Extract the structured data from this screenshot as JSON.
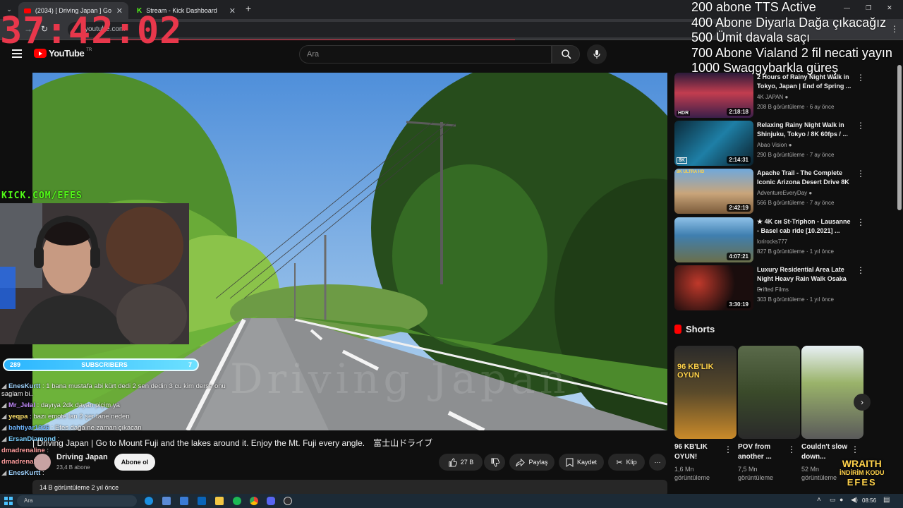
{
  "browser": {
    "tabs": [
      {
        "label": "(2034) [ Driving Japan ] Go to M",
        "active": true
      },
      {
        "label": "Stream - Kick Dashboard",
        "active": false
      }
    ],
    "new_tab": "+",
    "url": "youtube.com"
  },
  "overlay": {
    "timer": "37:42:02",
    "goals": [
      "200 abone TTS Active",
      "400 Abone Diyarla Dağa çıkacağız",
      "500 Ümit davala saçı",
      "700 Abone Vialand 2 fil necati yayın",
      "1000 Swaggybarkla güreş"
    ],
    "kick_handle": "KICK.COM/EFES",
    "subscribers": {
      "count": "289",
      "label": "SUBSCRIBERS",
      "goal_left": "7"
    },
    "chat": [
      {
        "user": "EnesKurtt",
        "msg": "1 bana mustafa abi kürt dedi 2 sen dedin 3 cu kim derse onu saglam bi..",
        "color": "#9fd3ff"
      },
      {
        "user": "Mr_Jelal",
        "msg": "dayıya 2dk dayan piçim ya",
        "color": "#c58cff"
      },
      {
        "user": "yeqpa",
        "msg": "bazı emote lan 2 şer tane neden",
        "color": "#ffe26b"
      },
      {
        "user": "bahtiyar1926",
        "msg": "Efes dağa ne zaman çıkacan",
        "color": "#6fb6ff"
      },
      {
        "user": "ErsanDiamond",
        "msg": "",
        "color": "#7ad0ff"
      },
      {
        "user": "dmadrenaline",
        "msg": "",
        "color": "#ff9d9d"
      },
      {
        "user": "dmadrenaline",
        "msg": "",
        "color": "#ff9d9d"
      },
      {
        "user": "EnesKurtt",
        "msg": "",
        "color": "#9fd3ff"
      }
    ],
    "wraith": {
      "line1": "WRAITH",
      "line2": "İNDİRİM KODU",
      "line3": "EFES"
    }
  },
  "youtube": {
    "logo_text": "YouTube",
    "logo_region": "TR",
    "search_placeholder": "Ara",
    "video": {
      "title": "| Driving Japan | Go to Mount Fuji and the lakes around it. Enjoy the Mt. Fuji every angle.　富士山ドライブ",
      "channel": "Driving Japan",
      "channel_subs": "23,4 B abone",
      "subscribe": "Abone ol",
      "likes": "27 B",
      "share": "Paylaş",
      "save": "Kaydet",
      "clip": "Klip",
      "description": "14 B görüntüleme  2 yıl önce",
      "watermark": "Driving Japan"
    },
    "recommendations": [
      {
        "title": "2 Hours of Rainy Night Walk in Tokyo, Japan | End of Spring ...",
        "channel": "4K JAPAN",
        "verified": true,
        "meta": "208 B görüntüleme · 6 ay önce",
        "duration": "2:18:18",
        "badge": "HDR"
      },
      {
        "title": "Relaxing Rainy Night Walk in Shinjuku, Tokyo / 8K 60fps / ...",
        "channel": "Abao Vision",
        "verified": true,
        "meta": "290 B görüntüleme · 7 ay önce",
        "duration": "2:14:31",
        "badge": "8K"
      },
      {
        "title": "Apache Trail - The Complete Iconic Arizona Desert Drive 8K",
        "channel": "AdventureEveryDay",
        "verified": true,
        "meta": "566 B görüntüleme · 7 ay önce",
        "duration": "2:42:19",
        "badge": "8K ULTRA HD"
      },
      {
        "title": "★ 4K ᴄʜ St-Triphon - Lausanne - Basel cab ride [10.2021] ...",
        "channel": "lorirocks777",
        "verified": false,
        "meta": "827 B görüntüleme · 1 yıl önce",
        "duration": "4:07:21",
        "badge": ""
      },
      {
        "title": "Luxury Residential Area Late Night Heavy Rain Walk Osaka ...",
        "channel": "Drifted Films",
        "verified": false,
        "meta": "303 B görüntüleme · 1 yıl önce",
        "duration": "3:30:19",
        "badge": ""
      }
    ],
    "shorts_heading": "Shorts",
    "shorts": [
      {
        "title": "96 KB'LIK OYUN!",
        "views": "1,6 Mn görüntüleme",
        "overlay": "96 KB'LIK OYUN"
      },
      {
        "title": "POV from another ...",
        "views": "7,5 Mn görüntüleme",
        "overlay": ""
      },
      {
        "title": "Couldn't slow down...",
        "views": "52 Mn görüntüleme",
        "overlay": ""
      }
    ]
  },
  "taskbar": {
    "search_text": "Ara",
    "time": "08:56"
  },
  "colors": {
    "yt_red": "#ff0000",
    "timer_red": "#e8374b",
    "kick_green": "#53fc18"
  }
}
